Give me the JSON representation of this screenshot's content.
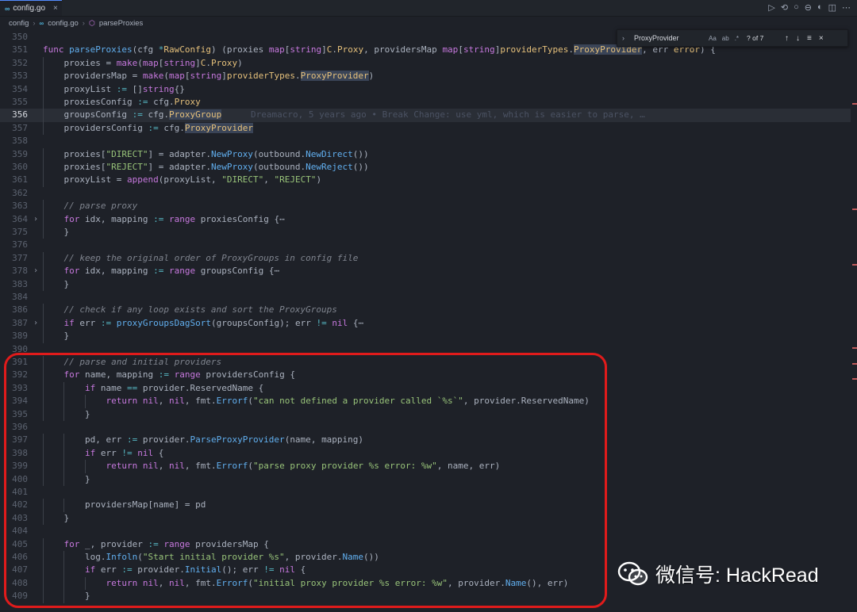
{
  "tab": {
    "label": "config.go",
    "close": "×"
  },
  "breadcrumb": {
    "folder": "config",
    "file": "config.go",
    "symbol": "parseProxies",
    "sep": "›"
  },
  "find": {
    "query": "ProxyProvider",
    "count": "? of 7",
    "match_case": "Aa",
    "whole_word": "ab",
    "regex": ".*"
  },
  "blame": "Dreamacro, 5 years ago • Break Change: use yml, which is easier to parse, …",
  "watermark": "微信号: HackRead",
  "colors": {
    "annotation": "#e01b1b",
    "accent": "#528bff"
  },
  "lines": [
    {
      "n": "350",
      "code": ""
    },
    {
      "n": "351",
      "code": "func parseProxies(cfg *RawConfig) (proxies map[string]C.Proxy, providersMap map[string]providerTypes.ProxyProvider, err error) {"
    },
    {
      "n": "352",
      "code": "    proxies = make(map[string]C.Proxy)"
    },
    {
      "n": "353",
      "code": "    providersMap = make(map[string]providerTypes.ProxyProvider)"
    },
    {
      "n": "354",
      "code": "    proxyList := []string{}"
    },
    {
      "n": "355",
      "code": "    proxiesConfig := cfg.Proxy"
    },
    {
      "n": "356",
      "code": "    groupsConfig := cfg.ProxyGroup"
    },
    {
      "n": "357",
      "code": "    providersConfig := cfg.ProxyProvider"
    },
    {
      "n": "358",
      "code": ""
    },
    {
      "n": "359",
      "code": "    proxies[\"DIRECT\"] = adapter.NewProxy(outbound.NewDirect())"
    },
    {
      "n": "360",
      "code": "    proxies[\"REJECT\"] = adapter.NewProxy(outbound.NewReject())"
    },
    {
      "n": "361",
      "code": "    proxyList = append(proxyList, \"DIRECT\", \"REJECT\")"
    },
    {
      "n": "362",
      "code": ""
    },
    {
      "n": "363",
      "code": "    // parse proxy"
    },
    {
      "n": "364",
      "code": "    for idx, mapping := range proxiesConfig {⋯"
    },
    {
      "n": "375",
      "code": "    }"
    },
    {
      "n": "376",
      "code": ""
    },
    {
      "n": "377",
      "code": "    // keep the original order of ProxyGroups in config file"
    },
    {
      "n": "378",
      "code": "    for idx, mapping := range groupsConfig {⋯"
    },
    {
      "n": "383",
      "code": "    }"
    },
    {
      "n": "384",
      "code": ""
    },
    {
      "n": "386",
      "code": "    // check if any loop exists and sort the ProxyGroups"
    },
    {
      "n": "387",
      "code": "    if err := proxyGroupsDagSort(groupsConfig); err != nil {⋯"
    },
    {
      "n": "389",
      "code": "    }"
    },
    {
      "n": "390",
      "code": ""
    },
    {
      "n": "391",
      "code": "    // parse and initial providers"
    },
    {
      "n": "392",
      "code": "    for name, mapping := range providersConfig {"
    },
    {
      "n": "393",
      "code": "        if name == provider.ReservedName {"
    },
    {
      "n": "394",
      "code": "            return nil, nil, fmt.Errorf(\"can not defined a provider called `%s`\", provider.ReservedName)"
    },
    {
      "n": "395",
      "code": "        }"
    },
    {
      "n": "396",
      "code": ""
    },
    {
      "n": "397",
      "code": "        pd, err := provider.ParseProxyProvider(name, mapping)"
    },
    {
      "n": "398",
      "code": "        if err != nil {"
    },
    {
      "n": "399",
      "code": "            return nil, nil, fmt.Errorf(\"parse proxy provider %s error: %w\", name, err)"
    },
    {
      "n": "400",
      "code": "        }"
    },
    {
      "n": "401",
      "code": ""
    },
    {
      "n": "402",
      "code": "        providersMap[name] = pd"
    },
    {
      "n": "403",
      "code": "    }"
    },
    {
      "n": "404",
      "code": ""
    },
    {
      "n": "405",
      "code": "    for _, provider := range providersMap {"
    },
    {
      "n": "406",
      "code": "        log.Infoln(\"Start initial provider %s\", provider.Name())"
    },
    {
      "n": "407",
      "code": "        if err := provider.Initial(); err != nil {"
    },
    {
      "n": "408",
      "code": "            return nil, nil, fmt.Errorf(\"initial proxy provider %s error: %w\", provider.Name(), err)"
    },
    {
      "n": "409",
      "code": "        }"
    }
  ]
}
